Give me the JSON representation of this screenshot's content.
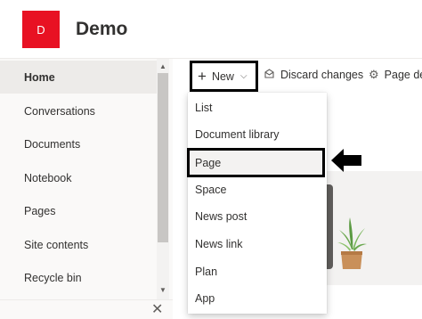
{
  "site": {
    "logo_letter": "D",
    "title": "Demo"
  },
  "sidebar": {
    "items": [
      {
        "label": "Home",
        "active": true
      },
      {
        "label": "Conversations"
      },
      {
        "label": "Documents"
      },
      {
        "label": "Notebook"
      },
      {
        "label": "Pages"
      },
      {
        "label": "Site contents"
      },
      {
        "label": "Recycle bin"
      }
    ]
  },
  "commandbar": {
    "new_label": "New",
    "discard_label": "Discard changes",
    "page_details_label": "Page de"
  },
  "new_menu": {
    "items": [
      {
        "label": "List"
      },
      {
        "label": "Document library"
      },
      {
        "label": "Page",
        "highlighted": true
      },
      {
        "label": "Space"
      },
      {
        "label": "News post"
      },
      {
        "label": "News link"
      },
      {
        "label": "Plan"
      },
      {
        "label": "App"
      }
    ]
  },
  "colors": {
    "logo": "#e81123",
    "annotation": "#000000"
  },
  "icons": [
    "plus-icon",
    "chevron-down-icon",
    "discard-icon",
    "gear-icon",
    "close-icon",
    "arrow-left-icon",
    "scroll-up-icon",
    "scroll-down-icon"
  ]
}
